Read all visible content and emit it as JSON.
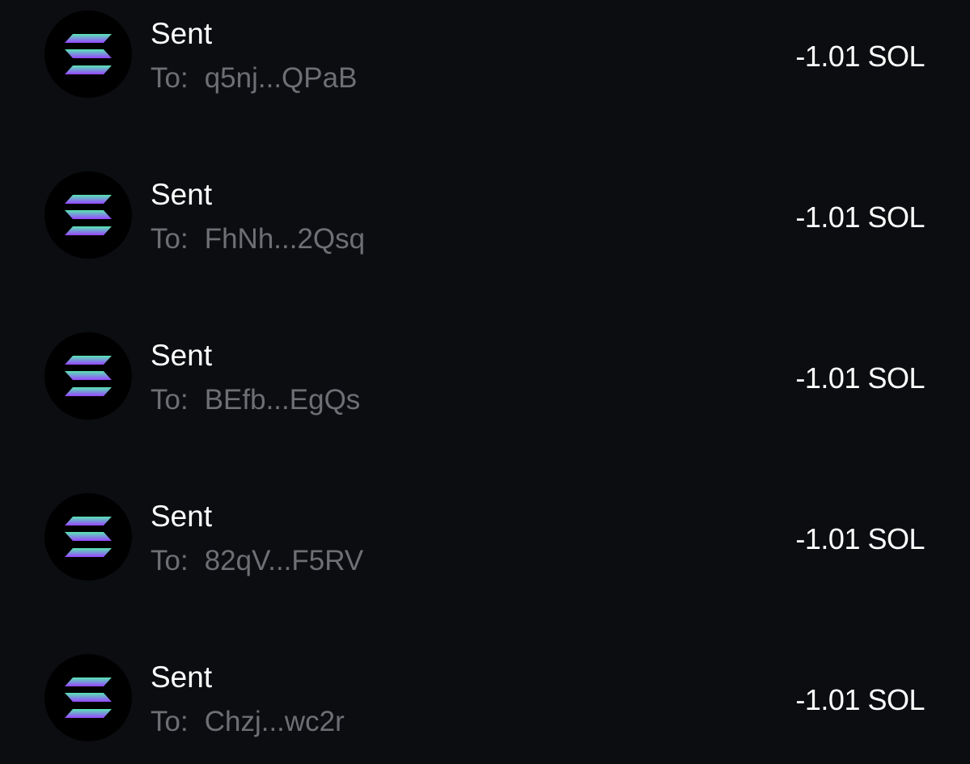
{
  "transactions": [
    {
      "title": "Sent",
      "to_label": "To:",
      "address": "q5nj...QPaB",
      "amount": "-1.01 SOL",
      "token_icon": "solana-icon"
    },
    {
      "title": "Sent",
      "to_label": "To:",
      "address": "FhNh...2Qsq",
      "amount": "-1.01 SOL",
      "token_icon": "solana-icon"
    },
    {
      "title": "Sent",
      "to_label": "To:",
      "address": "BEfb...EgQs",
      "amount": "-1.01 SOL",
      "token_icon": "solana-icon"
    },
    {
      "title": "Sent",
      "to_label": "To:",
      "address": "82qV...F5RV",
      "amount": "-1.01 SOL",
      "token_icon": "solana-icon"
    },
    {
      "title": "Sent",
      "to_label": "To:",
      "address": "Chzj...wc2r",
      "amount": "-1.01 SOL",
      "token_icon": "solana-icon"
    }
  ],
  "colors": {
    "background": "#0c0d11",
    "avatar_bg": "#000000",
    "primary_text": "#ffffff",
    "secondary_text": "#6e6f74",
    "solana_gradient_start": "#58e6b4",
    "solana_gradient_end": "#9945ff"
  }
}
